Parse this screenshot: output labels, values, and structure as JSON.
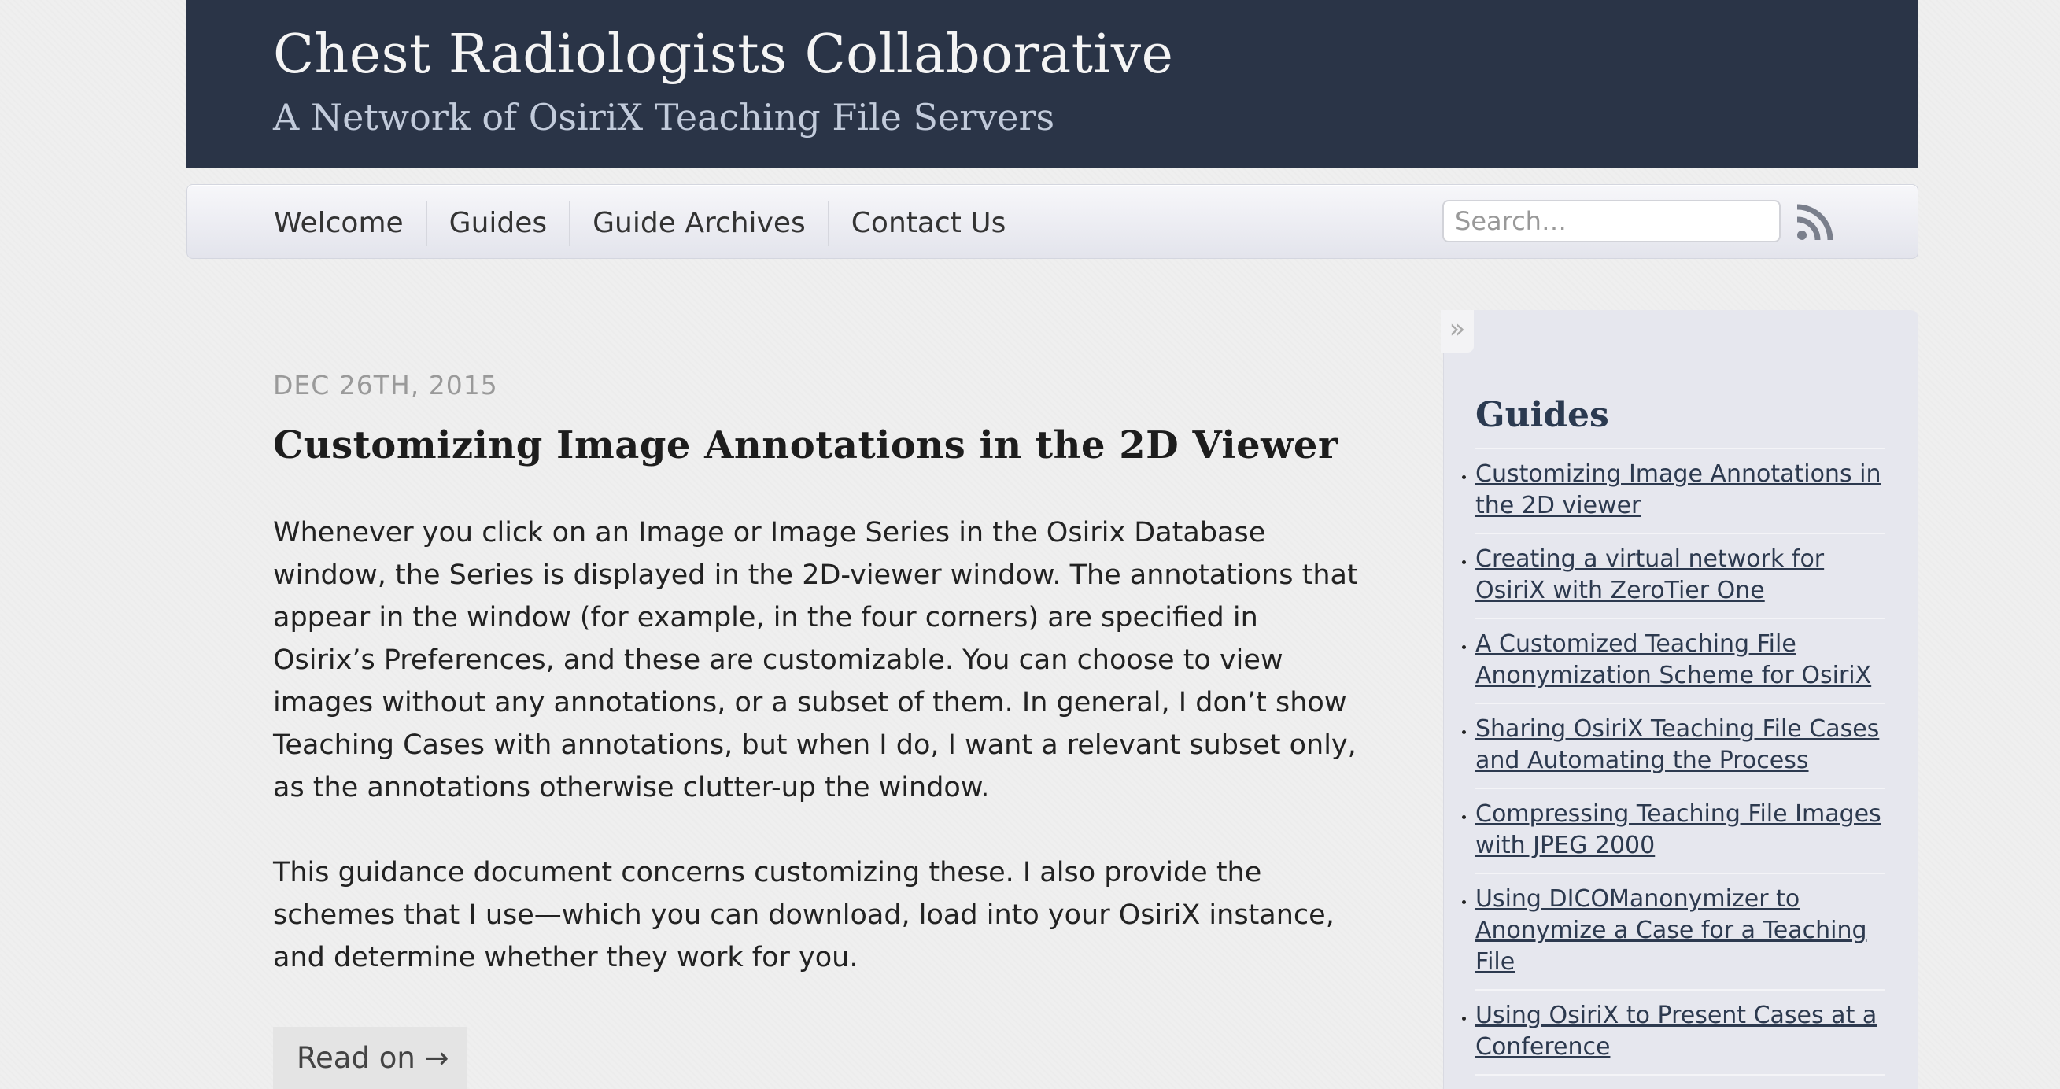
{
  "header": {
    "title": "Chest Radiologists Collaborative",
    "subtitle": "A Network of OsiriX Teaching File Servers"
  },
  "nav": {
    "items": [
      "Welcome",
      "Guides",
      "Guide Archives",
      "Contact Us"
    ],
    "search_placeholder": "Search…",
    "rss_icon": "rss-icon"
  },
  "post": {
    "date": "DEC 26TH, 2015",
    "title": "Customizing Image Annotations in the 2D Viewer",
    "paragraphs": [
      "Whenever you click on an Image or Image Series in the Osirix Database window, the Series is displayed in the 2D-viewer window. The annotations that appear in the window (for example, in the four corners) are specified in Osirix’s Preferences, and these are customizable. You can choose to view images without any annotations, or a subset of them. In general, I don’t show Teaching Cases with annotations, but when I do, I want a relevant subset only, as the annotations otherwise clutter-up the window.",
      "This guidance document concerns customizing these. I also provide the schemes that I use—which you can download, load into your OsiriX instance, and determine whether they work for you."
    ],
    "read_more": "Read on →"
  },
  "sidebar": {
    "toggle": "»",
    "heading": "Guides",
    "links": [
      "Customizing Image Annotations in the 2D viewer",
      "Creating a virtual network for OsiriX with ZeroTier One",
      "A Customized Teaching File Anonymization Scheme for OsiriX",
      "Sharing OsiriX Teaching File Cases and Automating the Process",
      "Compressing Teaching File Images with JPEG 2000",
      "Using DICOManonymizer to Anonymize a Case for a Teaching File",
      "Using OsiriX to Present Cases at a Conference"
    ]
  },
  "colors": {
    "banner": "#2a3447",
    "sidebar": "#e6e7ee",
    "rss": "#7a7f8c"
  }
}
